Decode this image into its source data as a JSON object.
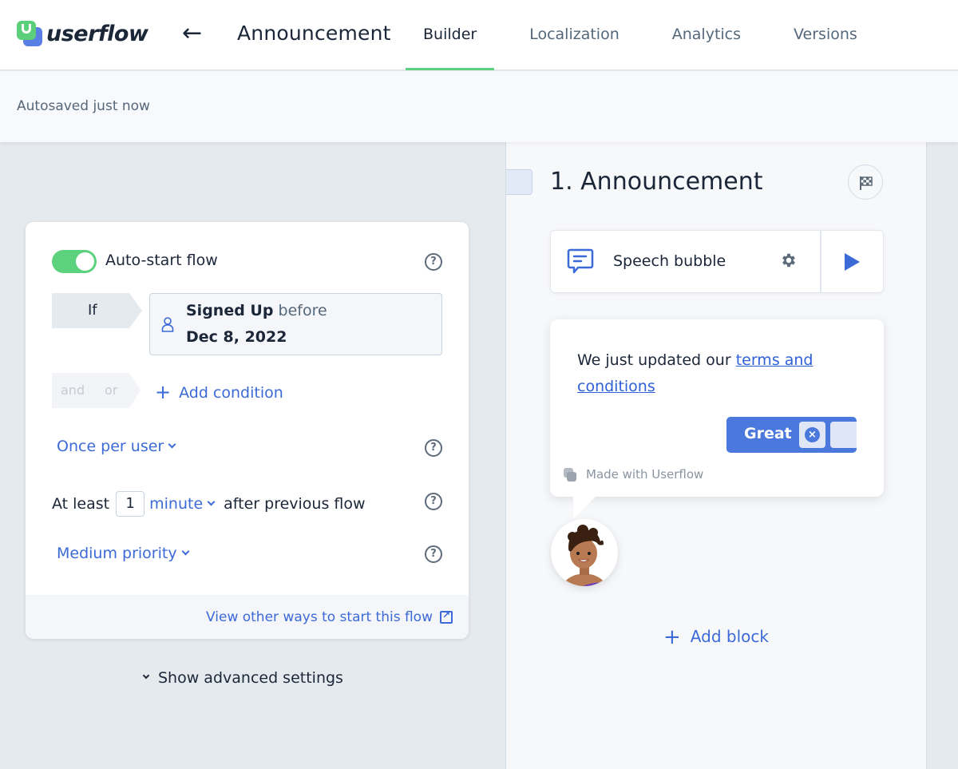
{
  "header": {
    "logo_text": "userflow",
    "back_icon": "arrow-left-icon",
    "flow_title": "Announcement",
    "tabs": [
      {
        "label": "Builder",
        "active": true
      },
      {
        "label": "Localization",
        "active": false
      },
      {
        "label": "Analytics",
        "active": false
      },
      {
        "label": "Versions",
        "active": false
      }
    ],
    "accent_color": "#5dd27e"
  },
  "status": {
    "autosaved": "Autosaved just now"
  },
  "start_settings": {
    "auto_start": {
      "label": "Auto-start flow",
      "enabled": true
    },
    "condition": {
      "prefix": "If",
      "attribute": "Signed Up",
      "operator": "before",
      "value": "Dec 8, 2022",
      "icon": "user-icon"
    },
    "logic": {
      "and": "and",
      "or": "or"
    },
    "add_condition": "Add condition",
    "frequency": "Once per user",
    "spacing": {
      "prefix": "At least",
      "value": "1",
      "unit": "minute",
      "suffix": "after previous flow"
    },
    "priority": "Medium priority",
    "view_other_ways": "View other ways to start this flow",
    "show_advanced": "Show advanced settings"
  },
  "step": {
    "title": "1. Announcement",
    "block": {
      "label": "Speech bubble",
      "icon": "speech-bubble-icon"
    },
    "preview": {
      "text_before_link": "We just updated our ",
      "link_text": "terms and conditions",
      "button_label": "Great",
      "made_with": "Made with Userflow"
    },
    "add_block": "Add block",
    "link_color": "#3c6ad8",
    "button_color": "#4a78dc"
  }
}
